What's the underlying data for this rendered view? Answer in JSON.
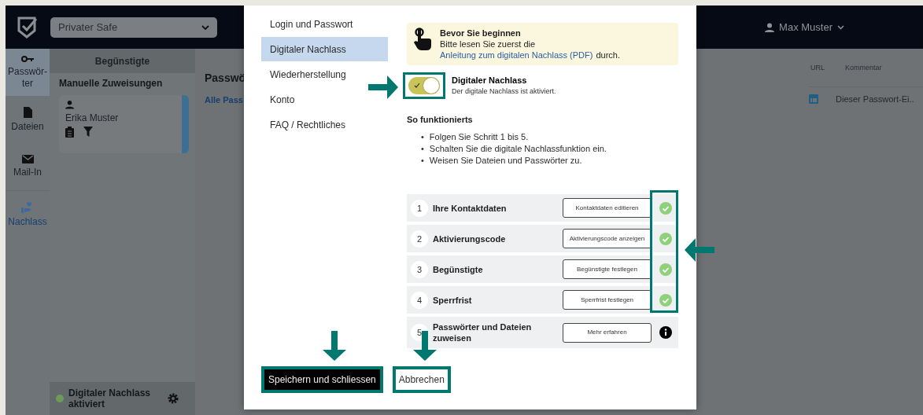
{
  "app_bar": {
    "safe_select": "Privater Safe",
    "user": "Max Muster"
  },
  "rail": [
    {
      "label": "Passwör-ter",
      "kind": "key",
      "selected": true,
      "color": "#1e2227"
    },
    {
      "label": "Dateien",
      "kind": "file",
      "selected": false,
      "color": "#1e2227"
    },
    {
      "label": "Mail-In",
      "kind": "mail",
      "selected": false,
      "color": "#1e2227"
    },
    {
      "label": "Nachlass",
      "kind": "heart",
      "selected": false,
      "color": "#173f6e"
    }
  ],
  "panel": {
    "title": "Begünstigte",
    "section": "Manuelle Zuweisungen",
    "beneficiary": {
      "name": "Erika Muster"
    },
    "footer": {
      "status": "Digitaler Nachlass aktiviert",
      "active": true
    }
  },
  "main": {
    "title": "Passwö",
    "filter": "Alle Pass",
    "columns": [
      "URL",
      "Kommentar"
    ],
    "rows": [
      {
        "comment": "Dieser Passwort-Ei.."
      }
    ]
  },
  "modal": {
    "nav": [
      {
        "label": "Login und Passwort",
        "selected": false
      },
      {
        "label": "Digitaler Nachlass",
        "selected": true
      },
      {
        "label": "Wiederherstellung",
        "selected": false
      },
      {
        "label": "Konto",
        "selected": false
      },
      {
        "label": "FAQ / Rechtliches",
        "selected": false
      }
    ],
    "notice": {
      "title": "Bevor Sie beginnen",
      "text": "Bitte lesen Sie zuerst die",
      "link": "Anleitung zum digitalen Nachlass (PDF)",
      "suffix": "durch."
    },
    "toggle": {
      "on": true,
      "label": "Digitaler Nachlass",
      "description": "Der digitale Nachlass ist aktiviert."
    },
    "how_title": "So funktionierts",
    "bullets": [
      {
        "marker": "•",
        "text": "Folgen Sie Schritt 1 bis 5."
      },
      {
        "marker": "•",
        "text": "Schalten Sie die digitale Nachlassfunktion ein."
      },
      {
        "marker": "•",
        "text": "Weisen Sie Dateien und Passwörter zu."
      }
    ],
    "steps": [
      {
        "number": "1",
        "title": "Ihre Kontaktdaten",
        "action": "Kontaktdaten editieren",
        "done": true
      },
      {
        "number": "2",
        "title": "Aktivierungscode",
        "action": "Aktivierungscode anzeigen",
        "done": true
      },
      {
        "number": "3",
        "title": "Begünstigte",
        "action": "Begünstigte festlegen",
        "done": true
      },
      {
        "number": "4",
        "title": "Sperrfrist",
        "action": "Sperrfrist festlegen",
        "done": true
      },
      {
        "number": "5",
        "title": "Passwörter und Dateien zuweisen",
        "action": "Mehr erfahren",
        "done": false
      }
    ],
    "buttons": {
      "save": "Speichern und schliessen",
      "cancel": "Abbrechen"
    }
  }
}
